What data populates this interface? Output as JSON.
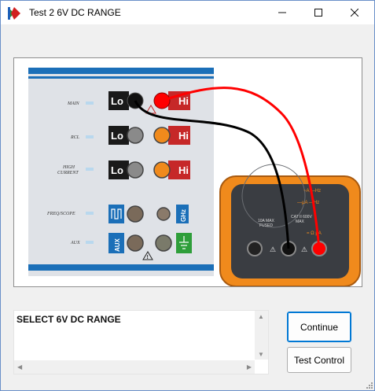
{
  "window": {
    "title": "Test 2 6V DC RANGE"
  },
  "controls": {
    "minimize_icon": "minimize-icon",
    "maximize_icon": "maximize-icon",
    "close_icon": "close-icon"
  },
  "panel": {
    "rows": [
      {
        "label": "MAIN",
        "lo": "Lo",
        "hi": "Hi"
      },
      {
        "label": "RCL",
        "lo": "Lo",
        "hi": "Hi"
      },
      {
        "label_line1": "HIGH",
        "label_line2": "CURRENT",
        "lo": "Lo",
        "hi": "Hi"
      },
      {
        "label": "FREQ/SCOPE",
        "hi": "GHz"
      },
      {
        "label": "AUX",
        "lo": "AUX"
      }
    ]
  },
  "meter": {
    "fused_label_1": "10A MAX",
    "fused_label_2": "FUSED",
    "cat_label_1": "CAT II 600V",
    "cat_label_2": "MAX"
  },
  "instruction": {
    "text": "SELECT 6V DC RANGE"
  },
  "buttons": {
    "continue_label": "Continue",
    "test_control_label": "Test Control"
  },
  "colors": {
    "lead_red": "#ff0000",
    "lead_black": "#000000",
    "panel_blue": "#1b6fb8",
    "meter_orange": "#f08a1c",
    "accent": "#0078d4"
  }
}
